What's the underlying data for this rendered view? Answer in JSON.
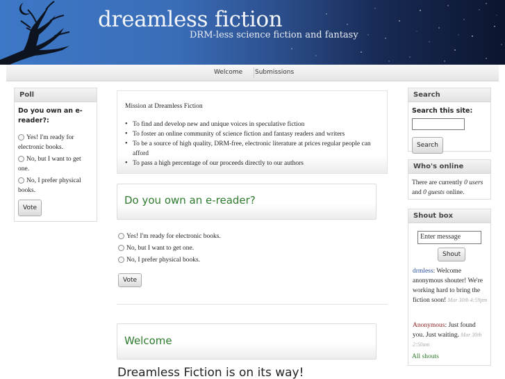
{
  "header": {
    "site_name": "dreamless fiction",
    "slogan": "DRM-less science fiction and fantasy"
  },
  "nav": {
    "items": [
      {
        "label": "Welcome"
      },
      {
        "label": "Submissions"
      }
    ]
  },
  "poll_block": {
    "title": "Poll",
    "question": "Do you own an e-reader?:",
    "choices": [
      "Yes! I'm ready for electronic books.",
      "No, but I want to get one.",
      "No, I prefer physical books."
    ],
    "vote_label": "Vote"
  },
  "mission": {
    "title": "Mission at Dreamless Fiction",
    "items": [
      "To find and develop new and unique voices in speculative fiction",
      "To foster an online community of science fiction and fantasy readers and writers",
      "To be a source of high quality, DRM-free, electronic literature at prices regular people can afford",
      "To pass a high percentage of our proceeds directly to our authors"
    ]
  },
  "main_poll": {
    "heading": "Do you own an e-reader?",
    "choices": [
      "Yes! I'm ready for electronic books.",
      "No, but I want to get one.",
      "No, I prefer physical books."
    ],
    "vote_label": "Vote"
  },
  "welcome": {
    "heading": "Welcome",
    "headline": "Dreamless Fiction is on its way!"
  },
  "search_block": {
    "title": "Search",
    "label": "Search this site:",
    "button": "Search"
  },
  "whos_online": {
    "title": "Who's online",
    "text_prefix": "There are currently ",
    "users": "0 users",
    "text_mid": " and ",
    "guests": "0 guests",
    "text_suffix": " online."
  },
  "shoutbox": {
    "title": "Shout box",
    "placeholder": "Enter message",
    "button": "Shout",
    "messages": [
      {
        "user": "drmless",
        "text": ": Welcome anonymous shouter! We're working hard to bring the fiction soon!",
        "time": "Mar 30th 4:59pm"
      },
      {
        "user": "Anonymous",
        "text": ": Just found you. Just waiting.",
        "time": "Mar 30th 2:50am"
      }
    ],
    "all_link": "All shouts"
  }
}
